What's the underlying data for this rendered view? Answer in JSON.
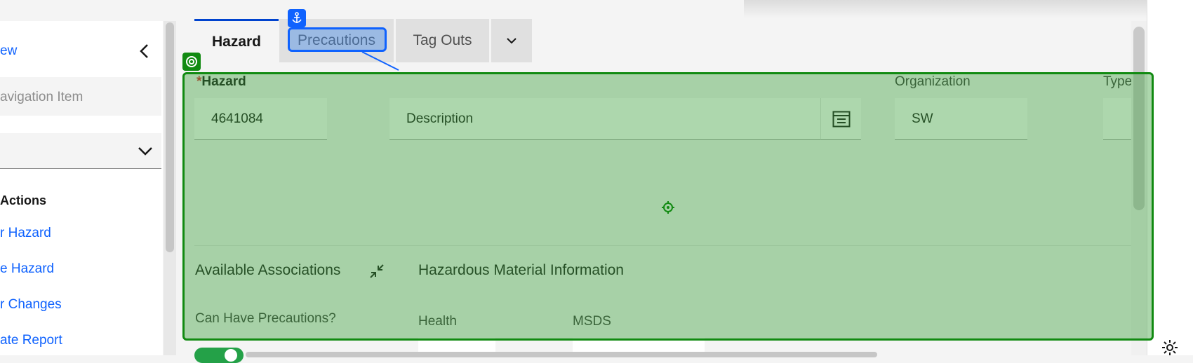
{
  "left_nav": {
    "view_link": "ew",
    "search_placeholder": "avigation Item",
    "actions_heading": "Actions",
    "action_links": [
      "r Hazard",
      "e Hazard",
      "r Changes",
      "ate Report"
    ]
  },
  "tabs": [
    {
      "label": "Hazard",
      "active": true
    },
    {
      "label": "Precautions",
      "active": false
    },
    {
      "label": "Tag Outs",
      "active": false
    }
  ],
  "form": {
    "hazard_label": "Hazard",
    "required_marker": "*",
    "hazard_value": "4641084",
    "description_placeholder": "Description",
    "organization_label": "Organization",
    "organization_value": "SW",
    "type_label": "Type",
    "associations_label": "Available Associations",
    "hazmat_label": "Hazardous Material Information",
    "can_have_precautions_label": "Can Have Precautions?",
    "health_label": "Health",
    "msds_label": "MSDS"
  },
  "colors": {
    "accent": "#0f62fe",
    "overlay_green": "#118a11",
    "required": "#da1e28"
  },
  "icons": {
    "collapse_nav": "chevron-left-icon",
    "select_dropdown": "chevron-down-icon",
    "tab_overflow": "chevron-down-icon",
    "description_detail": "long-description-icon",
    "associations_collapse": "minimize-icon",
    "anchor": "anchor-icon",
    "target": "target-icon",
    "settings": "gear-icon"
  }
}
